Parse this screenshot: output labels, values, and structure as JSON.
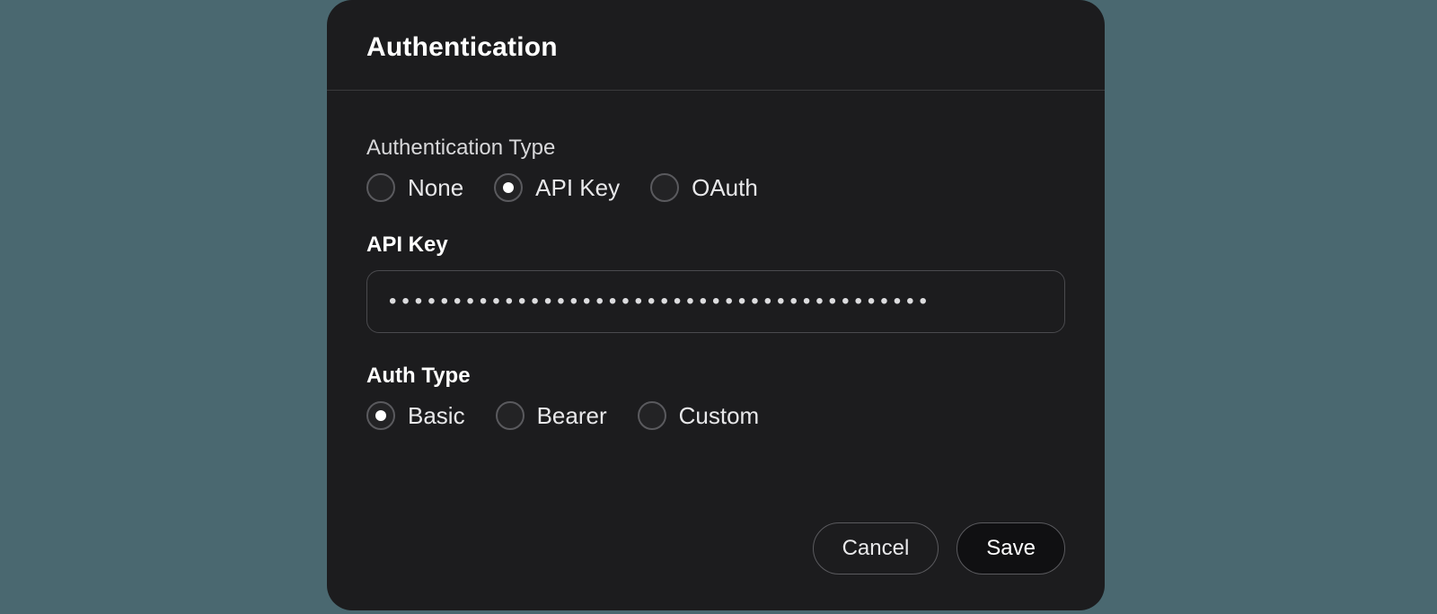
{
  "dialog": {
    "title": "Authentication",
    "auth_type_section": {
      "label": "Authentication Type",
      "options": [
        {
          "label": "None",
          "selected": false
        },
        {
          "label": "API Key",
          "selected": true
        },
        {
          "label": "OAuth",
          "selected": false
        }
      ]
    },
    "api_key_section": {
      "label": "API Key",
      "value": "••••••••••••••••••••••••••••••••••••••••••"
    },
    "sub_auth_type_section": {
      "label": "Auth Type",
      "options": [
        {
          "label": "Basic",
          "selected": true
        },
        {
          "label": "Bearer",
          "selected": false
        },
        {
          "label": "Custom",
          "selected": false
        }
      ]
    },
    "buttons": {
      "cancel": "Cancel",
      "save": "Save"
    }
  }
}
